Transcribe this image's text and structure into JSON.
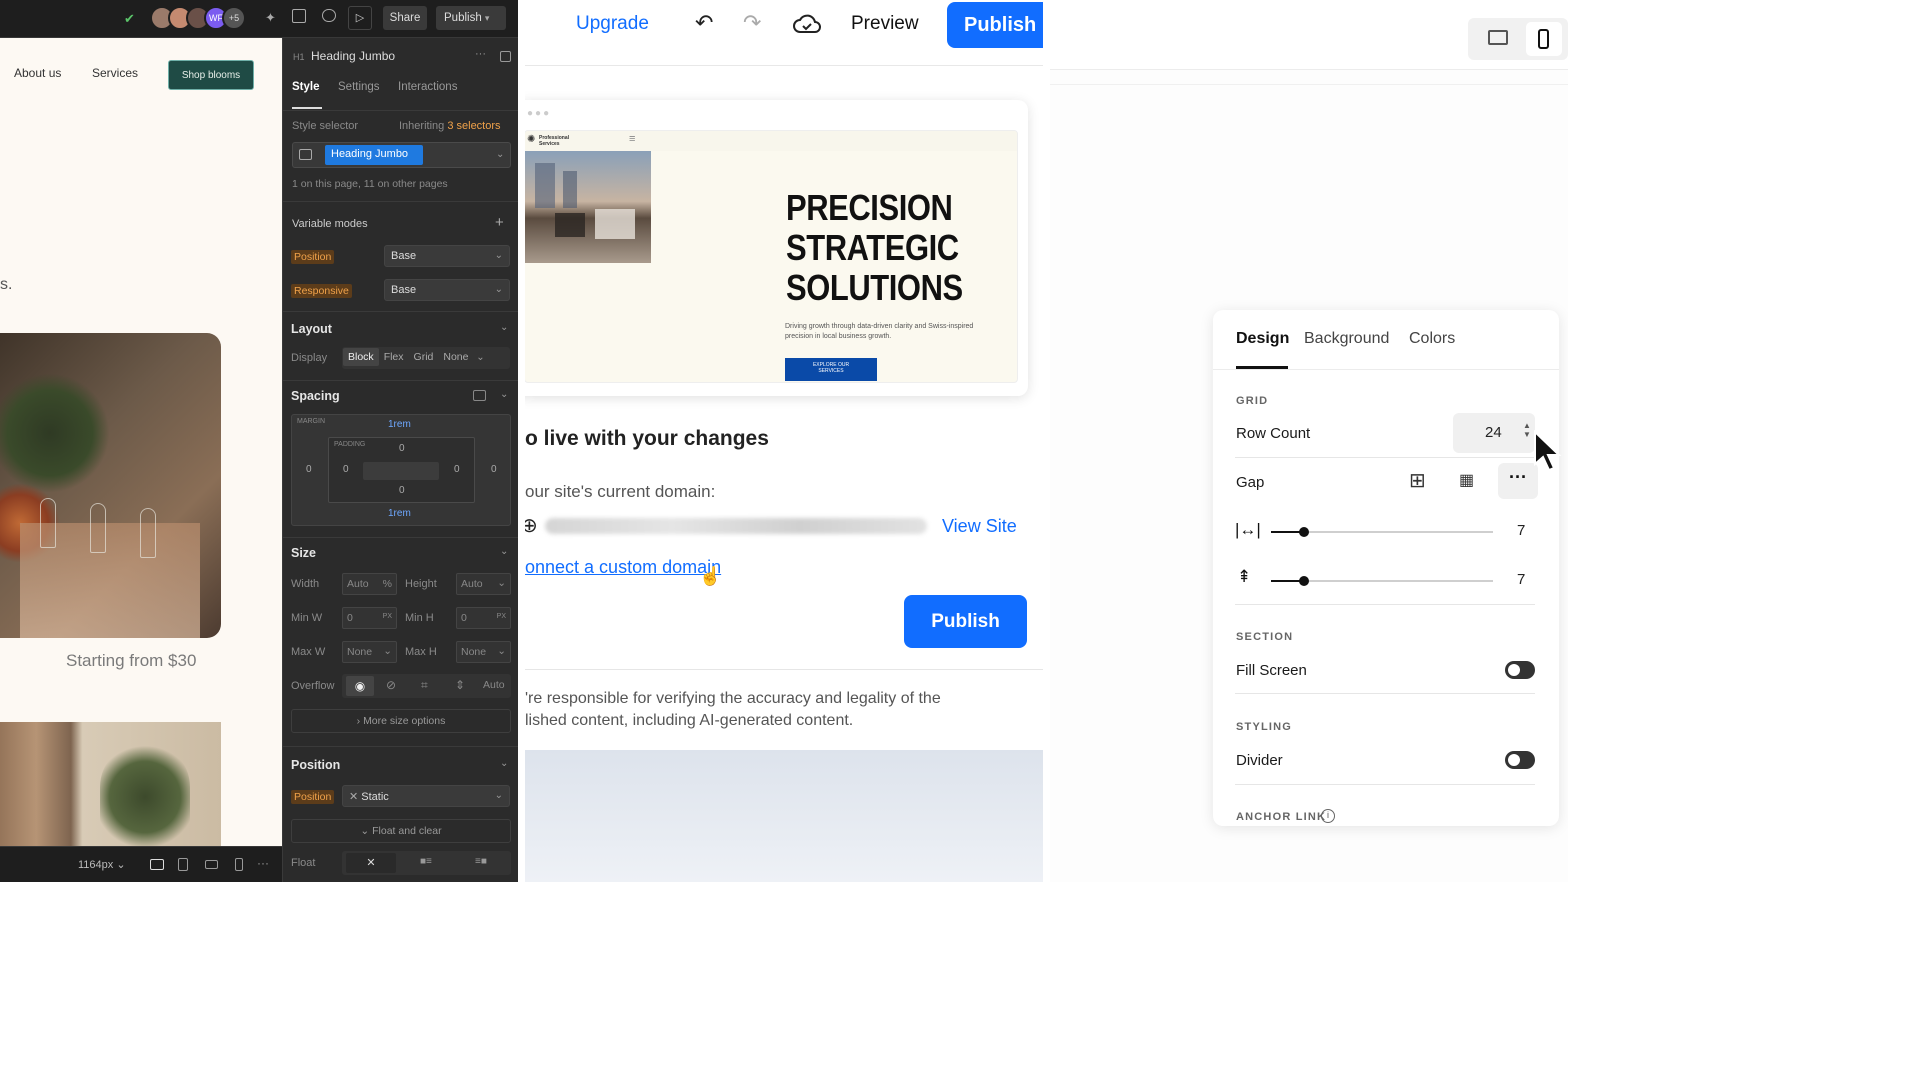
{
  "panel1": {
    "topbar": {
      "share_label": "Share",
      "publish_label": "Publish",
      "avatar_overflow": "+5",
      "avatar_initials": "WF"
    },
    "canvas": {
      "nav_about": "About us",
      "nav_services": "Services",
      "nav_cta": "Shop blooms",
      "stray_text": "s.",
      "price_text": "Starting from $30"
    },
    "bottombar": {
      "width_label": "1164px"
    },
    "sidebar": {
      "element_title": "Heading Jumbo",
      "tabs": [
        "Style",
        "Settings",
        "Interactions"
      ],
      "style_selector_label": "Style selector",
      "inheriting_label": "Inheriting",
      "inheriting_count": "3 selectors",
      "selector_chip": "Heading Jumbo",
      "usage_text": "1 on this page, 11 on other pages",
      "variable_modes": "Variable modes",
      "position_label": "Position",
      "position_value": "Base",
      "responsive_label": "Responsive",
      "responsive_value": "Base",
      "layout_header": "Layout",
      "display_label": "Display",
      "display_options": [
        "Block",
        "Flex",
        "Grid",
        "None"
      ],
      "spacing_header": "Spacing",
      "margin_label": "MARGIN",
      "padding_label": "PADDING",
      "margin_top": "1rem",
      "margin_bottom": "1rem",
      "margin_left": "0",
      "margin_right": "0",
      "padding_top": "0",
      "padding_bottom": "0",
      "padding_left": "0",
      "padding_right": "0",
      "size_header": "Size",
      "width_label": "Width",
      "width_value": "Auto",
      "width_unit": "%",
      "height_label": "Height",
      "height_value": "Auto",
      "minw_label": "Min W",
      "minw_value": "0",
      "minw_unit": "PX",
      "minh_label": "Min H",
      "minh_value": "0",
      "minh_unit": "PX",
      "maxw_label": "Max W",
      "maxw_value": "None",
      "maxh_label": "Max H",
      "maxh_value": "None",
      "overflow_label": "Overflow",
      "overflow_auto": "Auto",
      "more_size": "More size options",
      "position_header": "Position",
      "position2_label": "Position",
      "position2_value": "Static",
      "float_clear": "Float and clear",
      "float_label": "Float"
    }
  },
  "panel2": {
    "topbar": {
      "upgrade": "Upgrade",
      "preview": "Preview",
      "publish": "Publish"
    },
    "preview_card": {
      "logo_text": "Professional Services",
      "headline_1": "PRECISION",
      "headline_2": "STRATEGIC",
      "headline_3": "SOLUTIONS",
      "subtext": "Driving growth through data-driven clarity and Swiss-inspired precision in local business growth.",
      "cta": "EXPLORE OUR SERVICES"
    },
    "dialog": {
      "heading": "o live with your changes",
      "domain_label": "our site's current domain:",
      "view_site": "View Site",
      "custom_domain_link": "onnect a custom domain",
      "publish_button": "Publish",
      "disclaimer_1": "'re responsible for verifying the accuracy and legality of the",
      "disclaimer_2": "lished content, including AI-generated content."
    }
  },
  "panel3": {
    "tabs": [
      "Design",
      "Background",
      "Colors"
    ],
    "grid_caption": "GRID",
    "row_count_label": "Row Count",
    "row_count_value": "24",
    "gap_label": "Gap",
    "gap_h_value": "7",
    "gap_v_value": "7",
    "gap_h_fraction": 0.15,
    "gap_v_fraction": 0.15,
    "section_caption": "SECTION",
    "fill_screen_label": "Fill Screen",
    "styling_caption": "STYLING",
    "divider_label": "Divider",
    "anchor_caption": "ANCHOR LINK"
  }
}
